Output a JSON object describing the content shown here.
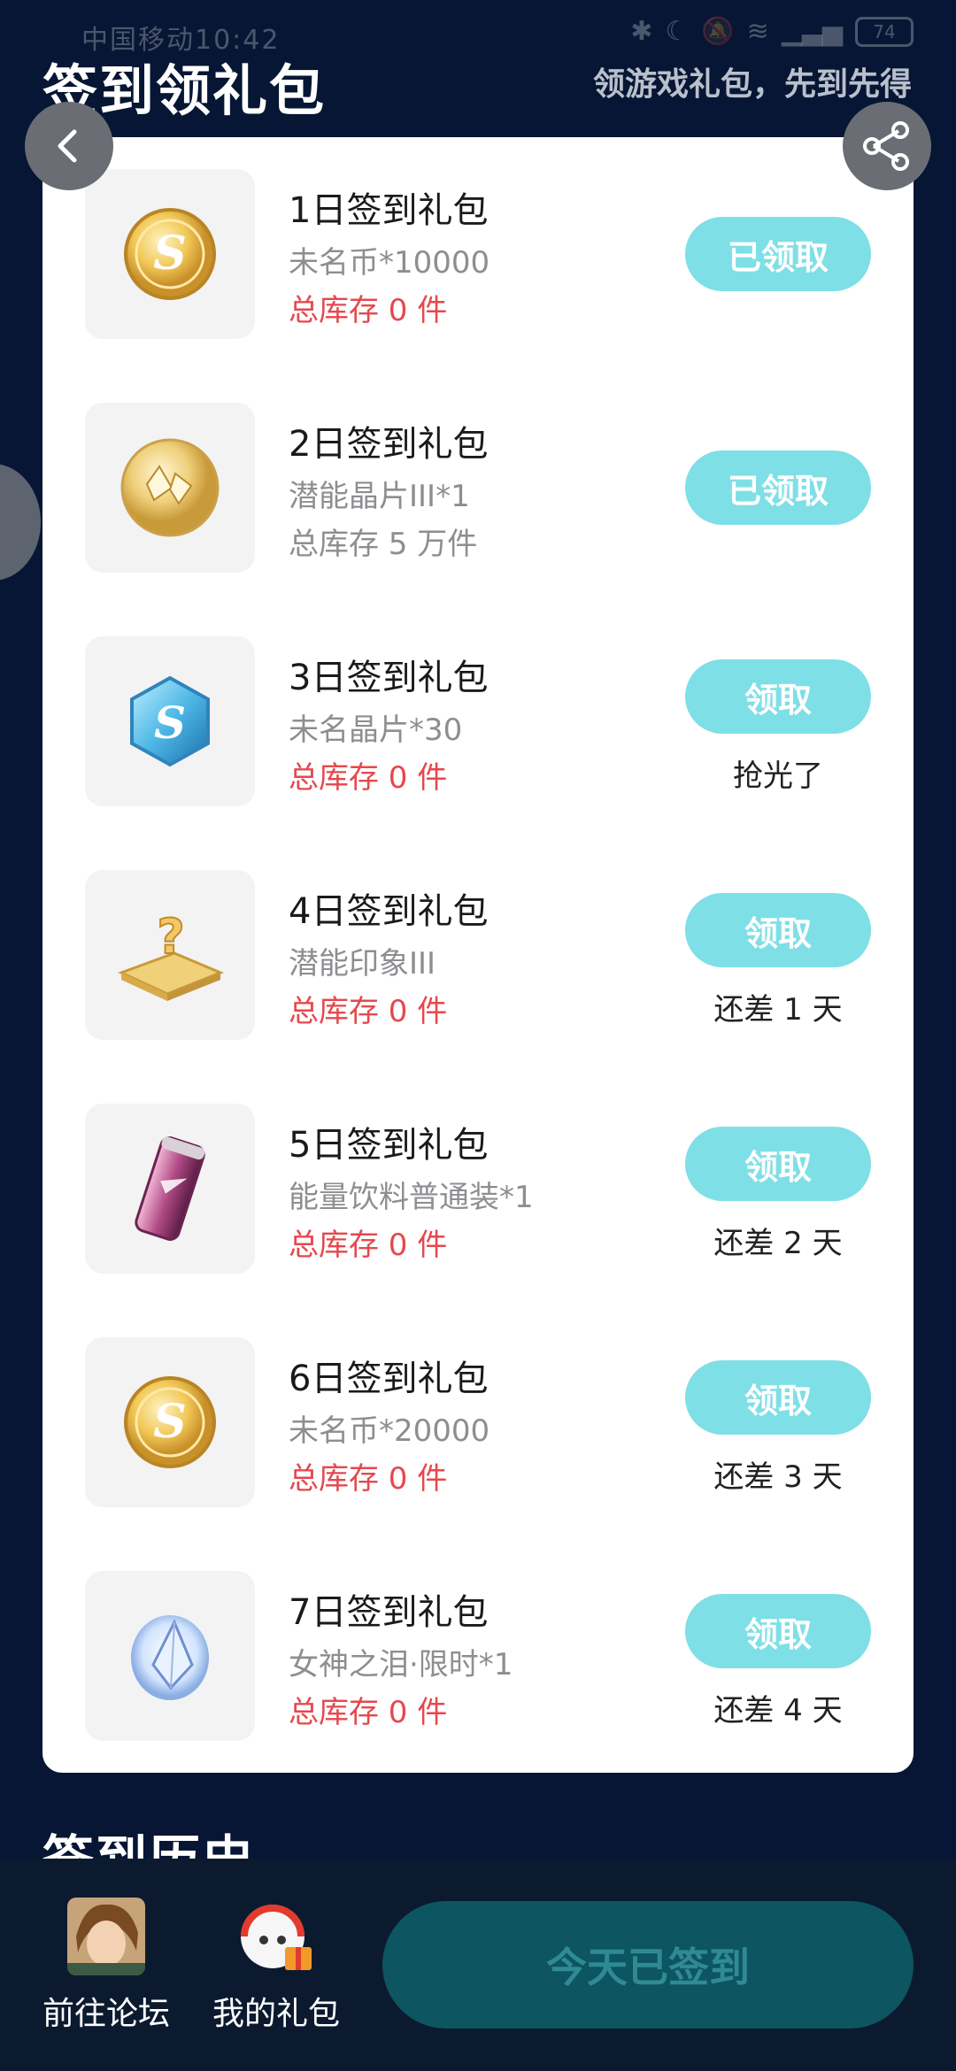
{
  "status_bar": {
    "carrier_time": "中国移动10:42",
    "battery": "74"
  },
  "header": {
    "title": "签到领礼包",
    "subtitle": "领游戏礼包，先到先得"
  },
  "colors": {
    "background": "#061634",
    "accent": "#7fdfe6",
    "stock_empty": "#e5484d",
    "stock_available": "#8e8e92"
  },
  "gifts": [
    {
      "name": "1日签到礼包",
      "item": "未名币*10000",
      "stock": "总库存 0 件",
      "stock_color": "#e5484d",
      "button": "已领取",
      "note": "",
      "icon": "coin-icon"
    },
    {
      "name": "2日签到礼包",
      "item": "潜能晶片III*1",
      "stock": "总库存 5 万件",
      "stock_color": "#8e8e92",
      "button": "已领取",
      "note": "",
      "icon": "crystal-coin-icon"
    },
    {
      "name": "3日签到礼包",
      "item": "未名晶片*30",
      "stock": "总库存 0 件",
      "stock_color": "#e5484d",
      "button": "领取",
      "note": "抢光了",
      "icon": "hexagon-chip-icon"
    },
    {
      "name": "4日签到礼包",
      "item": "潜能印象III",
      "stock": "总库存 0 件",
      "stock_color": "#e5484d",
      "button": "领取",
      "note": "还差 1 天",
      "icon": "mystery-card-icon"
    },
    {
      "name": "5日签到礼包",
      "item": "能量饮料普通装*1",
      "stock": "总库存 0 件",
      "stock_color": "#e5484d",
      "button": "领取",
      "note": "还差 2 天",
      "icon": "energy-drink-icon"
    },
    {
      "name": "6日签到礼包",
      "item": "未名币*20000",
      "stock": "总库存 0 件",
      "stock_color": "#e5484d",
      "button": "领取",
      "note": "还差 3 天",
      "icon": "coin-icon"
    },
    {
      "name": "7日签到礼包",
      "item": "女神之泪·限时*1",
      "stock": "总库存 0 件",
      "stock_color": "#e5484d",
      "button": "领取",
      "note": "还差 4 天",
      "icon": "tear-gem-icon"
    }
  ],
  "history": {
    "title": "签到历史"
  },
  "bottom_bar": {
    "forum_label": "前往论坛",
    "gifts_label": "我的礼包",
    "signed_label": "今天已签到"
  }
}
